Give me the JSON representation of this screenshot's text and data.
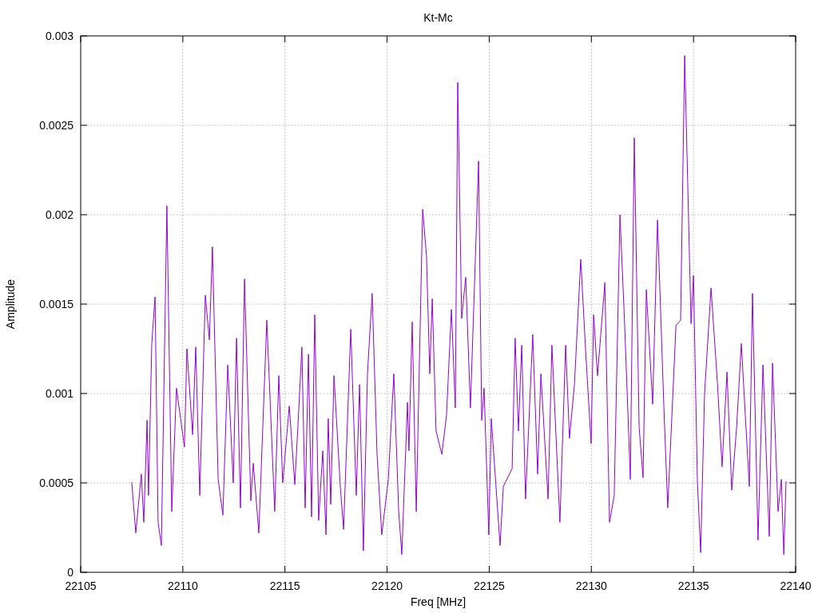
{
  "chart_data": {
    "type": "line",
    "grid": true,
    "title": "Kt-Mc",
    "xlabel": "Freq [MHz]",
    "ylabel": "Amplitude",
    "xlim": [
      22105,
      22140
    ],
    "ylim": [
      0,
      0.003
    ],
    "xticks": [
      22105,
      22110,
      22115,
      22120,
      22125,
      22130,
      22135,
      22140
    ],
    "yticks": [
      0,
      0.0005,
      0.001,
      0.0015,
      0.002,
      0.0025,
      0.003
    ],
    "x": [
      22107.5,
      22107.7,
      22107.97,
      22108.09,
      22108.25,
      22108.32,
      22108.48,
      22108.64,
      22108.79,
      22108.95,
      22109.22,
      22109.46,
      22109.69,
      22110.08,
      22110.2,
      22110.48,
      22110.63,
      22110.83,
      22111.1,
      22111.3,
      22111.45,
      22111.73,
      22111.96,
      22112.2,
      22112.47,
      22112.63,
      22112.82,
      22113.02,
      22113.33,
      22113.45,
      22113.72,
      22114.11,
      22114.5,
      22114.7,
      22114.89,
      22115.21,
      22115.48,
      22115.64,
      22115.83,
      22115.99,
      22116.15,
      22116.3,
      22116.46,
      22116.65,
      22116.85,
      22117.01,
      22117.12,
      22117.24,
      22117.4,
      22117.71,
      22117.87,
      22118.22,
      22118.49,
      22118.65,
      22118.84,
      22119.04,
      22119.27,
      22119.51,
      22119.74,
      22120.06,
      22120.33,
      22120.57,
      22120.72,
      22121,
      22121.07,
      22121.23,
      22121.43,
      22121.74,
      22121.93,
      22122.09,
      22122.21,
      22122.4,
      22122.68,
      22122.91,
      22123.15,
      22123.34,
      22123.46,
      22123.65,
      22123.85,
      22124.08,
      22124.48,
      22124.63,
      22124.75,
      22124.98,
      22125.1,
      22125.53,
      22125.69,
      22126.12,
      22126.27,
      22126.43,
      22126.59,
      22126.78,
      22127.13,
      22127.37,
      22127.53,
      22127.88,
      22128.07,
      22128.46,
      22128.74,
      22128.93,
      22129.17,
      22129.48,
      22129.72,
      22129.99,
      22130.11,
      22130.3,
      22130.66,
      22130.89,
      22131.12,
      22131.4,
      22131.63,
      22131.91,
      22132.1,
      22132.34,
      22132.53,
      22132.69,
      22133,
      22133.24,
      22133.55,
      22133.74,
      22134.14,
      22134.37,
      22134.57,
      22134.88,
      22135,
      22135.19,
      22135.35,
      22135.54,
      22135.86,
      22136.17,
      22136.4,
      22136.64,
      22136.87,
      22137.11,
      22137.34,
      22137.73,
      22137.89,
      22138.16,
      22138.4,
      22138.71,
      22138.87,
      22139.14,
      22139.3,
      22139.42,
      22139.53
    ],
    "series": [
      {
        "color": "#9400d3",
        "values": [
          0.000504,
          0.00022,
          0.00055,
          0.00028,
          0.00085,
          0.00043,
          0.00128,
          0.00154,
          0.00028,
          0.00015,
          0.00205,
          0.00034,
          0.00103,
          0.0007,
          0.00125,
          0.00077,
          0.00126,
          0.00043,
          0.00155,
          0.0013,
          0.00182,
          0.00052,
          0.00032,
          0.00116,
          0.0005,
          0.00131,
          0.00036,
          0.00164,
          0.0004,
          0.00061,
          0.00022,
          0.00141,
          0.00034,
          0.0011,
          0.0005,
          0.00093,
          0.00049,
          0.00083,
          0.00126,
          0.00036,
          0.00122,
          0.00031,
          0.00144,
          0.00029,
          0.00068,
          0.00021,
          0.00086,
          0.00038,
          0.0011,
          0.00048,
          0.00024,
          0.00136,
          0.00043,
          0.00105,
          0.00012,
          0.00111,
          0.00156,
          0.00066,
          0.00021,
          0.00052,
          0.00111,
          0.00034,
          0.0001,
          0.00095,
          0.00068,
          0.0014,
          0.00034,
          0.00203,
          0.00177,
          0.00111,
          0.00153,
          0.00079,
          0.00066,
          0.00088,
          0.00147,
          0.00092,
          0.00274,
          0.00142,
          0.00165,
          0.00092,
          0.0023,
          0.00085,
          0.00103,
          0.00021,
          0.00086,
          0.00015,
          0.00048,
          0.00058,
          0.00131,
          0.00079,
          0.00127,
          0.00041,
          0.00133,
          0.00055,
          0.00111,
          0.00041,
          0.00127,
          0.00028,
          0.00127,
          0.00075,
          0.00105,
          0.00175,
          0.00124,
          0.00072,
          0.00144,
          0.0011,
          0.00162,
          0.00028,
          0.00043,
          0.002,
          0.00138,
          0.00052,
          0.00243,
          0.00081,
          0.00053,
          0.00158,
          0.00094,
          0.00197,
          0.00092,
          0.00036,
          0.00138,
          0.00141,
          0.00289,
          0.00139,
          0.00166,
          0.00051,
          0.00011,
          0.001,
          0.00159,
          0.00106,
          0.00059,
          0.00112,
          0.00046,
          0.00081,
          0.00128,
          0.00048,
          0.00156,
          0.00018,
          0.00116,
          0.0002,
          0.00117,
          0.00034,
          0.00052,
          0.0001,
          0.00051
        ]
      }
    ]
  }
}
